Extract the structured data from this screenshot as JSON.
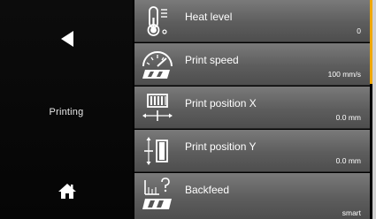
{
  "sidebar": {
    "back_icon": "back-arrow-icon",
    "mode_label": "Printing",
    "home_icon": "home-icon"
  },
  "menu": {
    "items": [
      {
        "label": "Heat level",
        "value": "0",
        "icon": "thermometer-icon"
      },
      {
        "label": "Print speed",
        "value": "100 mm/s",
        "icon": "speedometer-icon"
      },
      {
        "label": "Print position X",
        "value": "0.0 mm",
        "icon": "position-x-icon"
      },
      {
        "label": "Print position Y",
        "value": "0.0 mm",
        "icon": "position-y-icon"
      },
      {
        "label": "Backfeed",
        "value": "smart",
        "icon": "backfeed-icon"
      }
    ]
  },
  "colors": {
    "accent": "#f0a800",
    "item_background": "#666666",
    "sidebar_background": "#0a0a0a"
  }
}
